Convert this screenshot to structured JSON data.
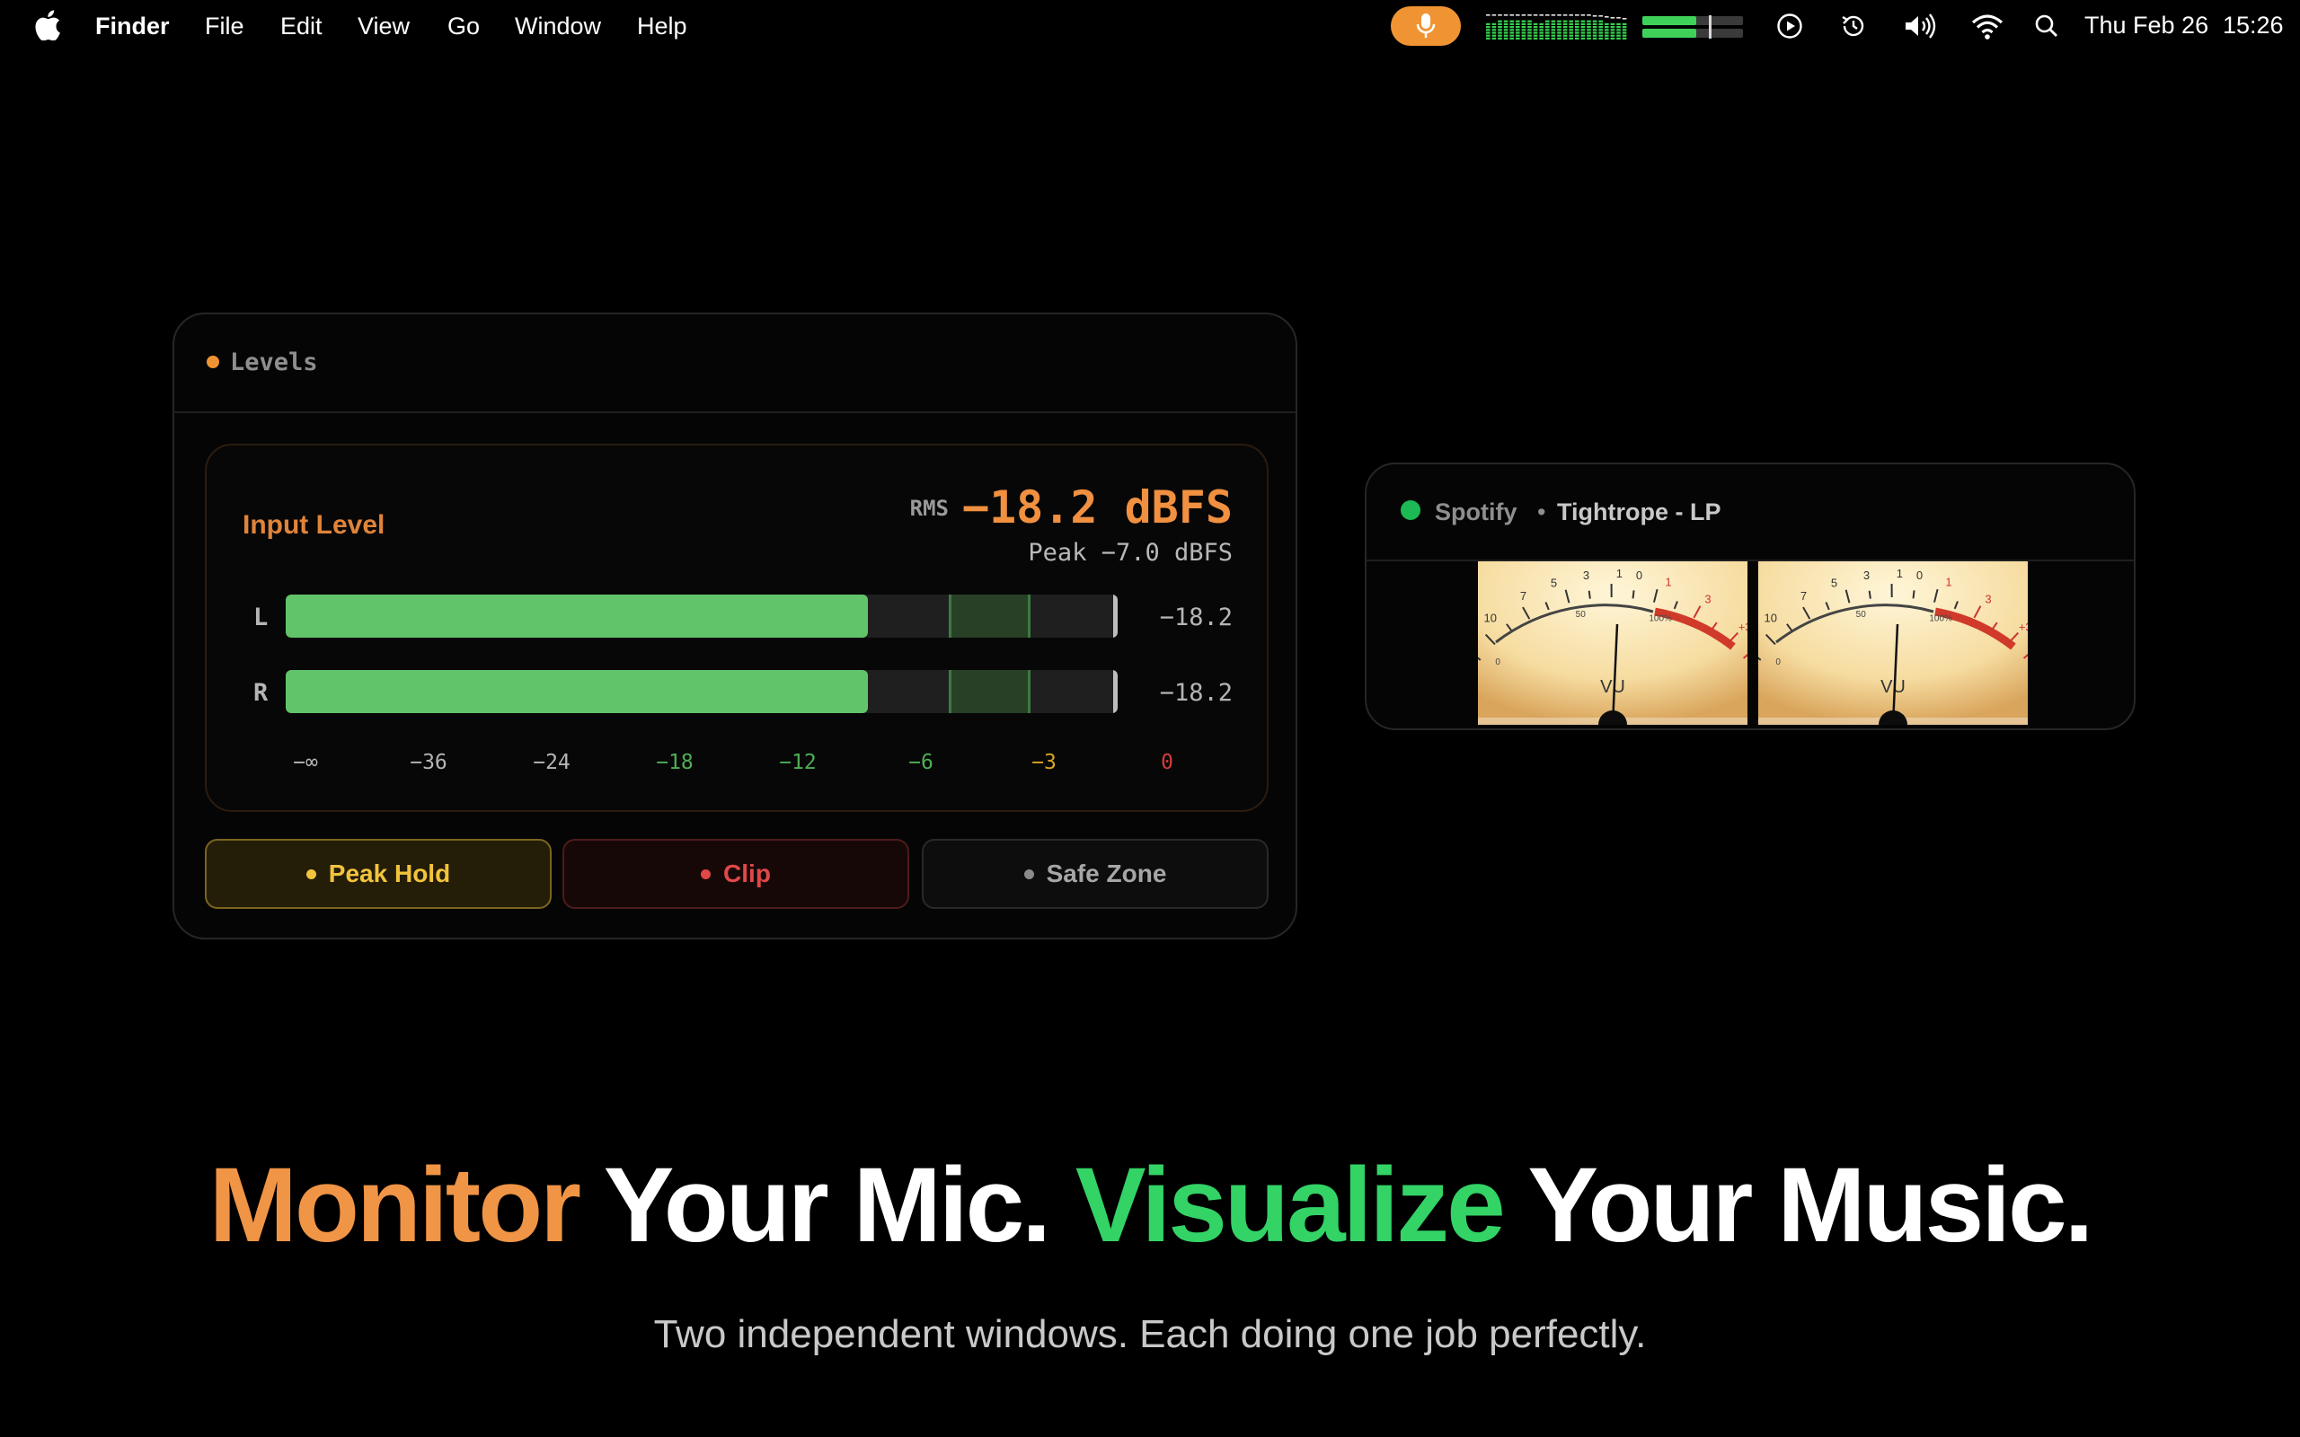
{
  "menubar": {
    "app_name": "Finder",
    "menus": [
      "File",
      "Edit",
      "View",
      "Go",
      "Window",
      "Help"
    ],
    "icons": [
      "apple-logo-icon",
      "microphone-icon",
      "equalizer-icon",
      "level-meter-icon",
      "play-circle-icon",
      "time-machine-icon",
      "volume-icon",
      "wifi-icon",
      "search-icon"
    ],
    "date": "Thu Feb 26",
    "time": "15:26",
    "mic_color": "#f09433"
  },
  "levels_window": {
    "title": "Levels",
    "dot_color": "#f09433",
    "input_label": "Input Level",
    "rms_label": "RMS",
    "rms_value": "−18.2 dBFS",
    "peak_text": "Peak −7.0 dBFS",
    "channels": [
      {
        "label": "L",
        "value": "−18.2",
        "level": 0.7
      },
      {
        "label": "R",
        "value": "−18.2",
        "level": 0.7
      }
    ],
    "scale": [
      {
        "label": "−∞",
        "color": "#b5b5b5"
      },
      {
        "label": "−36",
        "color": "#b5b5b5"
      },
      {
        "label": "−24",
        "color": "#b5b5b5"
      },
      {
        "label": "−18",
        "color": "#4fae55"
      },
      {
        "label": "−12",
        "color": "#4fae55"
      },
      {
        "label": "−6",
        "color": "#4fae55"
      },
      {
        "label": "−3",
        "color": "#d8a520"
      },
      {
        "label": "0",
        "color": "#d63c3c"
      }
    ],
    "buttons": {
      "peak_hold": "Peak Hold",
      "clip": "Clip",
      "safe_zone": "Safe Zone"
    }
  },
  "spotify_window": {
    "app": "Spotify",
    "separator": "•",
    "track": "Tightrope - LP",
    "meter_label": "VU",
    "meter_scale": [
      "-20",
      "10",
      "7",
      "5",
      "3",
      "1",
      "0",
      "1",
      "3",
      "+3"
    ],
    "meter_sub_scale": [
      "0",
      "50",
      "100%"
    ]
  },
  "hero": {
    "word1": "Monitor",
    "word2": "Your Mic.",
    "word3": "Visualize",
    "word4": "Your Music.",
    "subtitle": "Two independent windows. Each doing one job perfectly."
  }
}
